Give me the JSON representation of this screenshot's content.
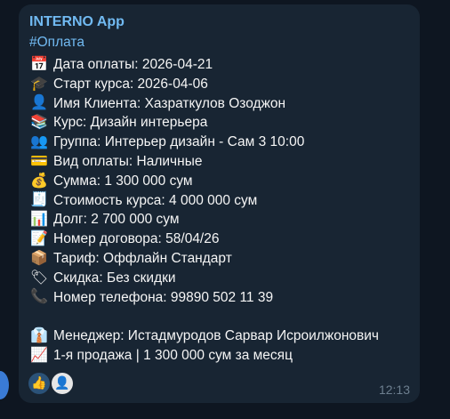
{
  "message": {
    "sender": "INTERNO App",
    "hashtag": "#Оплата",
    "lines": [
      {
        "icon": "calendar-icon",
        "glyph": "📅",
        "text": "Дата оплаты: 2026-04-21"
      },
      {
        "icon": "graduation-cap-icon",
        "glyph": "🎓",
        "text": "Старт курса: 2026-04-06"
      },
      {
        "icon": "user-icon",
        "glyph": "👤",
        "text": "Имя Клиента: Хазраткулов Озоджон"
      },
      {
        "icon": "books-icon",
        "glyph": "📚",
        "text": "Курс: Дизайн интерьера"
      },
      {
        "icon": "group-icon",
        "glyph": "👥",
        "text": "Группа: Интерьер дизайн - Сам 3 10:00"
      },
      {
        "icon": "credit-card-icon",
        "glyph": "💳",
        "text": "Вид оплаты: Наличные"
      },
      {
        "icon": "money-bag-icon",
        "glyph": "💰",
        "text": "Сумма: 1 300 000 сум"
      },
      {
        "icon": "receipt-icon",
        "glyph": "🧾",
        "text": "Стоимость курса: 4 000 000 сум"
      },
      {
        "icon": "bar-chart-icon",
        "glyph": "📊",
        "text": "Долг: 2 700 000 сум"
      },
      {
        "icon": "memo-icon",
        "glyph": "📝",
        "text": "Номер договора: 58/04/26"
      },
      {
        "icon": "package-icon",
        "glyph": "📦",
        "text": "Тариф: Оффлайн Стандарт"
      },
      {
        "icon": "tag-icon",
        "glyph": "🏷",
        "text": "Скидка: Без скидки"
      },
      {
        "icon": "phone-icon",
        "glyph": "📞",
        "text": "Номер телефона: 99890 502 11 39"
      }
    ],
    "footer_lines": [
      {
        "icon": "manager-icon",
        "glyph": "👔",
        "text": "Менеджер: Истадмуродов Сарвар Исроилжонович"
      },
      {
        "icon": "trend-up-icon",
        "glyph": "📈",
        "text": "1-я продажа | 1 300 000 сум за месяц"
      }
    ],
    "reactions": [
      {
        "icon": "thumbs-up-icon",
        "glyph": "👍"
      },
      {
        "icon": "reactor-avatar-icon",
        "glyph": "👤"
      }
    ],
    "time": "12:13"
  }
}
